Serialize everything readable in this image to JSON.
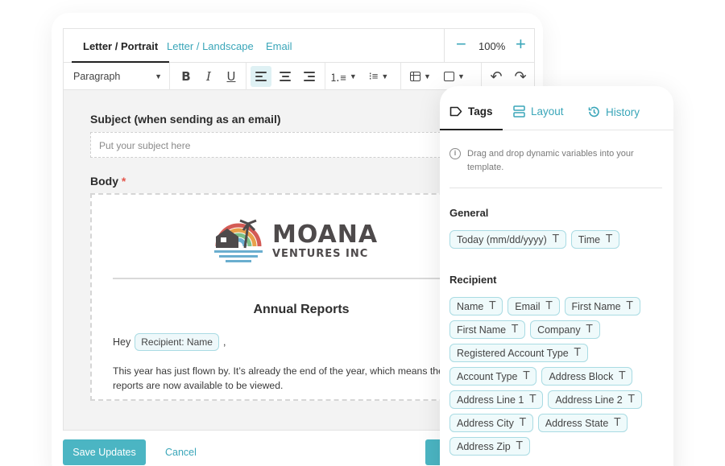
{
  "editor": {
    "tabs": [
      {
        "label": "Letter / Portrait",
        "active": true
      },
      {
        "label": "Letter / Landscape",
        "active": false
      },
      {
        "label": "Email",
        "active": false
      }
    ],
    "zoom": {
      "minus": "−",
      "value": "100%",
      "plus": "+"
    },
    "toolbar": {
      "paragraph_select": "Paragraph",
      "buttons": [
        "bold",
        "italic",
        "underline",
        "align-left",
        "align-center",
        "align-right",
        "ordered-list",
        "bulleted-list",
        "table",
        "image",
        "undo",
        "redo"
      ],
      "active_button": "align-left"
    },
    "subject_label": "Subject (when sending as an email)",
    "subject_placeholder": "Put your subject here",
    "body_label": "Body",
    "body_required_mark": "*",
    "document": {
      "logo_line1": "MOANA",
      "logo_line2": "VENTURES INC",
      "title": "Annual Reports",
      "greeting": "Hey",
      "greeting_tag": "Recipient: Name",
      "greeting_suffix": ",",
      "paragraph_line1": "This year has just flown by. It’s already the end of the year, which means the",
      "paragraph_line2": "reports are now available to be viewed."
    },
    "save_button": "Save Updates",
    "cancel_link": "Cancel"
  },
  "panel": {
    "tabs": [
      {
        "label": "Tags",
        "icon": "tag-icon",
        "active": true
      },
      {
        "label": "Layout",
        "icon": "layout-icon",
        "active": false
      },
      {
        "label": "History",
        "icon": "history-icon",
        "active": false
      }
    ],
    "info_text": "Drag and drop dynamic variables into your template.",
    "general": {
      "title": "General",
      "tags": [
        "Today (mm/dd/yyyy)",
        "Time"
      ]
    },
    "recipient": {
      "title": "Recipient",
      "tags": [
        "Name",
        "Email",
        "First Name",
        "First Name",
        "Company",
        "Registered Account Type",
        "Account Type",
        "Address Block",
        "Address Line 1",
        "Address Line 2",
        "Address City",
        "Address State",
        "Address Zip"
      ]
    },
    "tag_icon_glyph": "T"
  },
  "colors": {
    "accent": "#3aa6b9",
    "button": "#4bb5c3",
    "tag_border": "#a9dbe3",
    "tag_bg": "#effafb",
    "required": "#e4574d"
  }
}
